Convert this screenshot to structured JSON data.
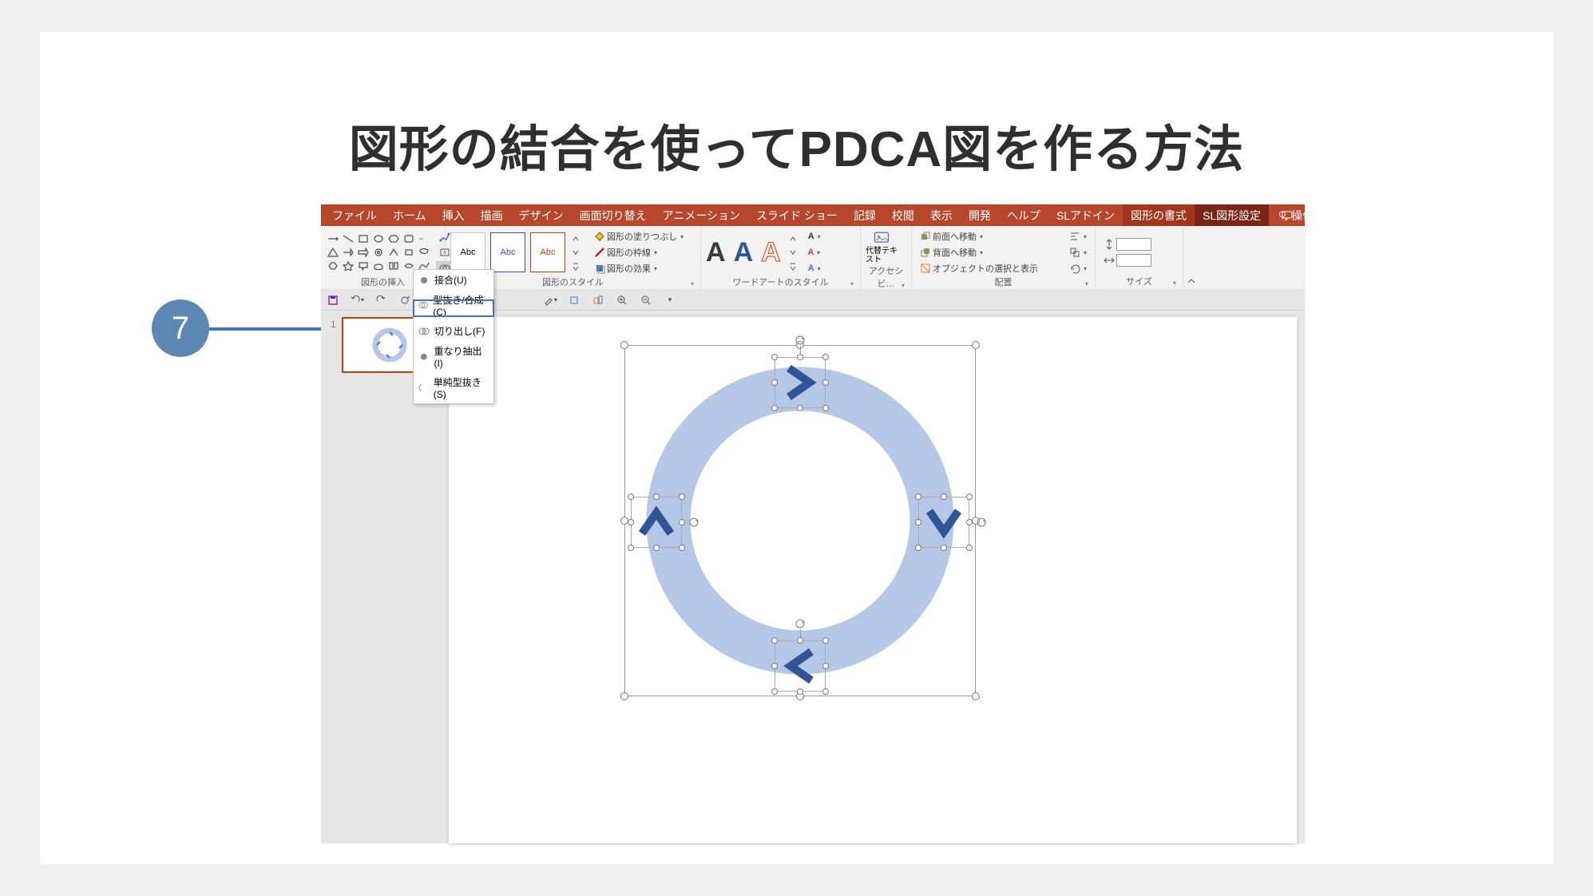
{
  "heading": "図形の結合を使ってPDCA図を作る方法",
  "annotation": {
    "step_number": "7"
  },
  "tabs": {
    "file": "ファイル",
    "home": "ホーム",
    "insert": "挿入",
    "draw": "描画",
    "design": "デザイン",
    "transitions": "画面切り替え",
    "animations": "アニメーション",
    "slideshow": "スライド ショー",
    "record": "記録",
    "review": "校閲",
    "view": "表示",
    "developer": "開発",
    "help": "ヘルプ",
    "sl_addin": "SLアドイン",
    "shape_format": "図形の書式",
    "sl_shape": "SL図形設定",
    "tell_me": "操作アシ"
  },
  "ribbon": {
    "insert_shapes": {
      "label": "図形の挿入"
    },
    "shape_styles": {
      "label": "図形のスタイル",
      "fill": "図形の塗りつぶし",
      "outline": "図形の枠線",
      "effects": "図形の効果"
    },
    "abc": "Abc",
    "wordart": {
      "label": "ワードアートのスタイル"
    },
    "access": {
      "label": "アクセシビ…",
      "alt_text": "代替テキスト"
    },
    "arrange": {
      "label": "配置",
      "bring_forward": "前面へ移動",
      "send_backward": "背面へ移動",
      "selection_pane": "オブジェクトの選択と表示"
    },
    "size": {
      "label": "サイズ"
    }
  },
  "merge_menu": {
    "union": "接合(U)",
    "combine": "型抜き/合成(C)",
    "fragment": "切り出し(F)",
    "intersect": "重なり抽出(I)",
    "subtract": "単純型抜き(S)"
  },
  "thumbnail": {
    "number": "1"
  }
}
